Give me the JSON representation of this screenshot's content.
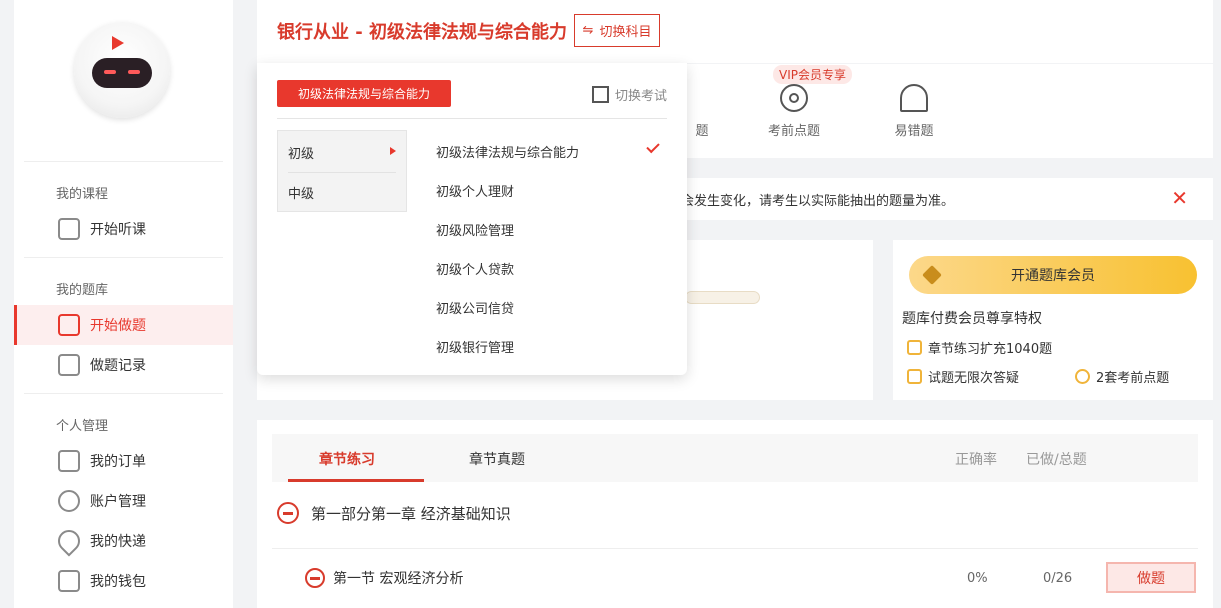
{
  "sidebar": {
    "sections": [
      {
        "title": "我的课程",
        "items": [
          {
            "label": "开始听课",
            "icon": "play-icon"
          }
        ]
      },
      {
        "title": "我的题库",
        "items": [
          {
            "label": "开始做题",
            "icon": "edit-icon"
          },
          {
            "label": "做题记录",
            "icon": "record-icon"
          }
        ]
      },
      {
        "title": "个人管理",
        "items": [
          {
            "label": "我的订单",
            "icon": "order-icon"
          },
          {
            "label": "账户管理",
            "icon": "account-icon"
          },
          {
            "label": "我的快递",
            "icon": "location-icon"
          },
          {
            "label": "我的钱包",
            "icon": "wallet-icon"
          }
        ]
      }
    ]
  },
  "header": {
    "title": "银行从业 - 初级法律法规与综合能力",
    "switch_label": "切换科目"
  },
  "quick_tools": [
    {
      "label": "题",
      "icon": "doc-icon"
    },
    {
      "label": "考前点题",
      "icon": "target-icon"
    },
    {
      "label": "易错题",
      "icon": "alarm-icon"
    }
  ],
  "vip_tag": "VIP会员专享",
  "notice": {
    "text": "会发生变化，请考生以实际能抽出的题量为准。",
    "close": "✕"
  },
  "member": {
    "button": "开通题库会员",
    "privilege_title": "题库付费会员尊享特权",
    "privileges": [
      "章节练习扩充1040题",
      "试题无限次答疑",
      "2套考前点题"
    ]
  },
  "chapter": {
    "tabs": [
      "章节练习",
      "章节真题"
    ],
    "columns": [
      "正确率",
      "已做/总题"
    ],
    "part": "第一部分第一章 经济基础知识",
    "section": {
      "title": "第一节 宏观经济分析",
      "accuracy": "0%",
      "done": "0/26",
      "action": "做题"
    }
  },
  "dropdown": {
    "current": "初级法律法规与综合能力",
    "switch_exam": "切换考试",
    "levels": [
      "初级",
      "中级"
    ],
    "subjects": [
      "初级法律法规与综合能力",
      "初级个人理财",
      "初级风险管理",
      "初级个人贷款",
      "初级公司信贷",
      "初级银行管理"
    ]
  },
  "colors": {
    "accent": "#d83b2c",
    "vip_gold": "#f8c131"
  }
}
